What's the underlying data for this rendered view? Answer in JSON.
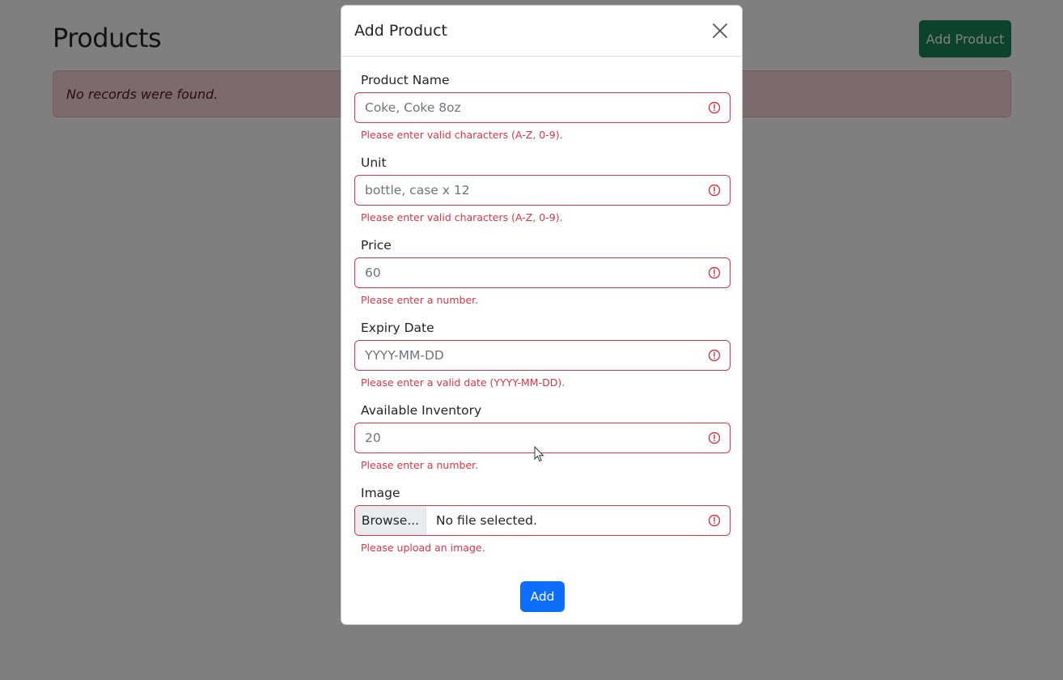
{
  "page": {
    "title": "Products",
    "add_button": "Add Product",
    "empty_message": "No records were found."
  },
  "modal": {
    "title": "Add Product",
    "submit_label": "Add",
    "fields": [
      {
        "label": "Product Name",
        "placeholder": "Coke, Coke 8oz",
        "feedback": "Please enter valid characters (A-Z, 0-9)."
      },
      {
        "label": "Unit",
        "placeholder": "bottle, case x 12",
        "feedback": "Please enter valid characters (A-Z, 0-9)."
      },
      {
        "label": "Price",
        "placeholder": "60",
        "feedback": "Please enter a number."
      },
      {
        "label": "Expiry Date",
        "placeholder": "YYYY-MM-DD",
        "feedback": "Please enter a valid date (YYYY-MM-DD)."
      },
      {
        "label": "Available Inventory",
        "placeholder": "20",
        "feedback": "Please enter a number."
      }
    ],
    "image_field": {
      "label": "Image",
      "browse_label": "Browse...",
      "file_status": "No file selected.",
      "feedback": "Please upload an image."
    }
  },
  "colors": {
    "primary": "#0d6efd",
    "success": "#198754",
    "danger": "#dc3545",
    "alert_bg": "#f8d7da"
  },
  "icons": [
    "close-icon",
    "invalid-icon",
    "mouse-cursor-icon"
  ]
}
